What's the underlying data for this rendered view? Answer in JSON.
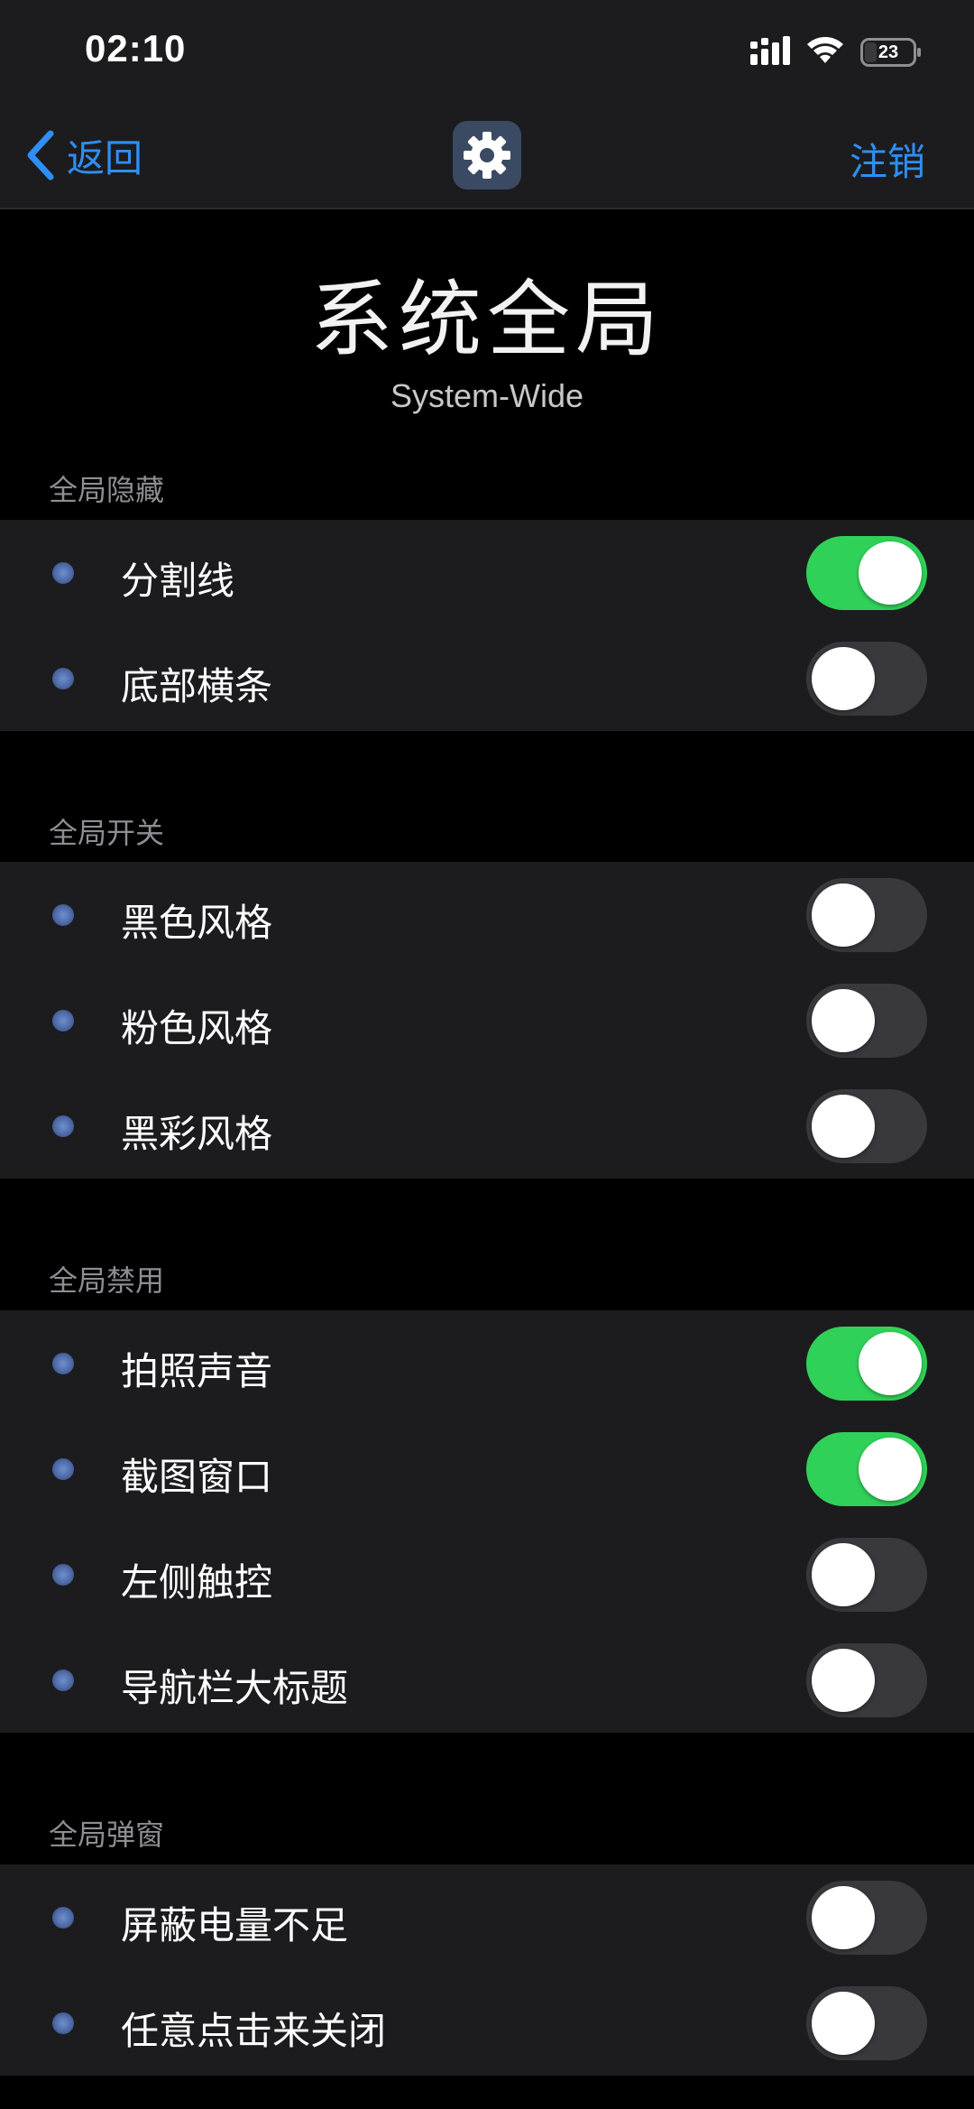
{
  "status_bar": {
    "time": "02:10",
    "battery_level": "23"
  },
  "nav": {
    "back_label": "返回",
    "logout_label": "注销",
    "center_icon": "gear-icon"
  },
  "header": {
    "title": "系统全局",
    "subtitle": "System-Wide"
  },
  "colors": {
    "accent": "#2f8ff6",
    "toggle_on": "#30d158",
    "toggle_off": "#39393d"
  },
  "sections": [
    {
      "title": "全局隐藏",
      "items": [
        {
          "label": "分割线",
          "on": true
        },
        {
          "label": "底部横条",
          "on": false
        }
      ]
    },
    {
      "title": "全局开关",
      "items": [
        {
          "label": "黑色风格",
          "on": false
        },
        {
          "label": "粉色风格",
          "on": false
        },
        {
          "label": "黑彩风格",
          "on": false
        }
      ]
    },
    {
      "title": "全局禁用",
      "items": [
        {
          "label": "拍照声音",
          "on": true
        },
        {
          "label": "截图窗口",
          "on": true
        },
        {
          "label": "左侧触控",
          "on": false
        },
        {
          "label": "导航栏大标题",
          "on": false
        }
      ]
    },
    {
      "title": "全局弹窗",
      "items": [
        {
          "label": "屏蔽电量不足",
          "on": false
        },
        {
          "label": "任意点击来关闭",
          "on": false
        }
      ]
    }
  ]
}
